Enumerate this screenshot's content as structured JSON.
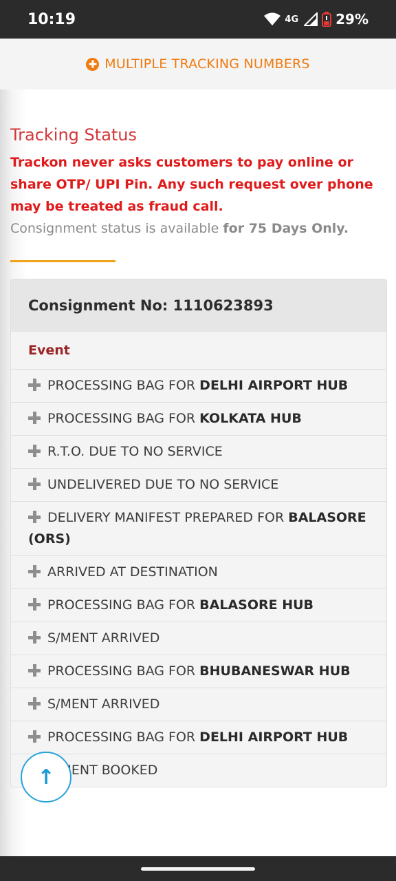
{
  "status_bar": {
    "time": "10:19",
    "network": "4G",
    "battery": "29%"
  },
  "header": {
    "multi_tracking_label": "MULTIPLE TRACKING NUMBERS",
    "accent_color": "#ef7a10"
  },
  "tracking": {
    "title": "Tracking Status",
    "warning": "Trackon never asks customers to pay online or share OTP/ UPI Pin. Any such request over phone may be treated as fraud call.",
    "availability_prefix": "Consignment status is available",
    "availability_bold": "for 75 Days Only."
  },
  "consignment": {
    "label": "Consignment No: 1110623893",
    "event_header": "Event",
    "events": [
      {
        "text": "PROCESSING BAG FOR ",
        "bold": "DELHI AIRPORT HUB"
      },
      {
        "text": "PROCESSING BAG FOR ",
        "bold": "KOLKATA HUB"
      },
      {
        "text": "R.T.O. DUE TO NO SERVICE",
        "bold": ""
      },
      {
        "text": "UNDELIVERED DUE TO NO SERVICE",
        "bold": ""
      },
      {
        "text": "DELIVERY MANIFEST PREPARED FOR ",
        "bold": "BALASORE (ORS)"
      },
      {
        "text": "ARRIVED AT DESTINATION",
        "bold": ""
      },
      {
        "text": "PROCESSING BAG FOR ",
        "bold": "BALASORE HUB"
      },
      {
        "text": "S/MENT ARRIVED",
        "bold": ""
      },
      {
        "text": "PROCESSING BAG FOR ",
        "bold": "BHUBANESWAR HUB"
      },
      {
        "text": "S/MENT ARRIVED",
        "bold": ""
      },
      {
        "text": "PROCESSING BAG FOR ",
        "bold": "DELHI AIRPORT HUB"
      },
      {
        "text": "S/MENT BOOKED",
        "bold": ""
      }
    ]
  },
  "scroll_top": {
    "icon": "arrow-up-icon",
    "glyph": "↑"
  }
}
